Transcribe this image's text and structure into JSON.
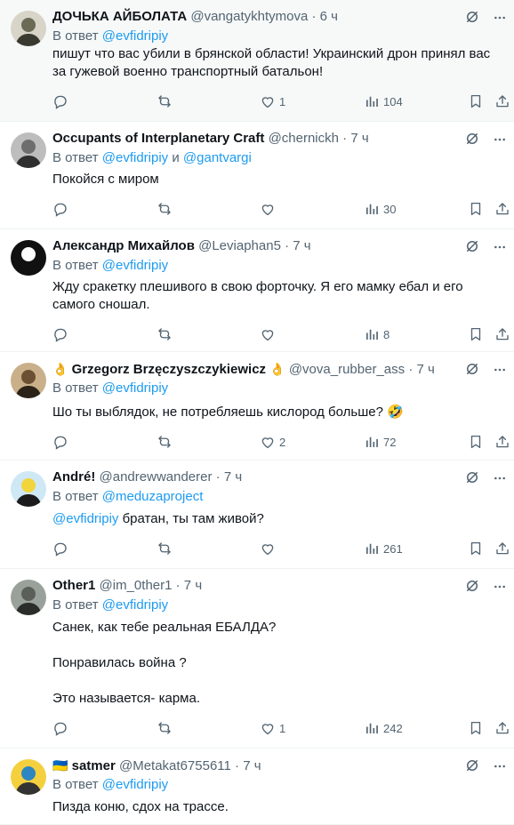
{
  "reply_prefix": "В ответ",
  "conjunction": "и",
  "tweets": [
    {
      "name": "ДОЧЬКА АЙБОЛАТА",
      "name_emoji": "",
      "name_emoji_after": "",
      "handle": "@vangatykhtymova",
      "time": "· 6 ч",
      "reply_to": [
        "@evfidripiy"
      ],
      "lines": [
        "пишут  что вас убили в брянской области! Украинский  дрон принял вас  за гужевой военно транспортный батальон!"
      ],
      "mention_lead": "",
      "replies": "",
      "retweets": "",
      "likes": "1",
      "views": "104",
      "avatar_colors": [
        "#d8d4c8",
        "#6a6a55",
        "#3a3a30"
      ]
    },
    {
      "name": "Occupants of Interplanetary Craft",
      "name_emoji": "",
      "name_emoji_after": "",
      "handle": "@chernickh",
      "time": "· 7 ч",
      "reply_to": [
        "@evfidripiy",
        "@gantvargi"
      ],
      "lines": [
        "Покойся с миром"
      ],
      "mention_lead": "",
      "replies": "",
      "retweets": "",
      "likes": "",
      "views": "30",
      "avatar_colors": [
        "#bdbdbd",
        "#6e6e6e",
        "#2f2f2f"
      ]
    },
    {
      "name": "Александр Михайлов",
      "name_emoji": "",
      "name_emoji_after": "",
      "handle": "@Leviaphan5",
      "time": "· 7 ч",
      "reply_to": [
        "@evfidripiy"
      ],
      "lines": [
        "Жду сракетку плешивого в свою форточку. Я его мамку ебал и его самого сношал."
      ],
      "mention_lead": "",
      "replies": "",
      "retweets": "",
      "likes": "",
      "views": "8",
      "avatar_colors": [
        "#111111",
        "#ffffff",
        "#111111"
      ]
    },
    {
      "name": "Grzegorz Brzęczyszczykiewicz",
      "name_emoji": "👌",
      "name_emoji_after": "👌",
      "handle": "@vova_rubber_ass",
      "time": "· 7 ч",
      "reply_to": [
        "@evfidripiy"
      ],
      "lines": [
        "Шо ты выблядок, не потребляешь кислород больше? 🤣"
      ],
      "mention_lead": "",
      "replies": "",
      "retweets": "",
      "likes": "2",
      "views": "72",
      "avatar_colors": [
        "#c9b08a",
        "#6b5033",
        "#2b2218"
      ]
    },
    {
      "name": "André!",
      "name_emoji": "",
      "name_emoji_after": "",
      "handle": "@andrewwanderer",
      "time": "· 7 ч",
      "reply_to": [
        "@meduzaproject"
      ],
      "lines": [
        "братан, ты там живой?"
      ],
      "mention_lead": "@evfidripiy",
      "replies": "",
      "retweets": "",
      "likes": "",
      "views": "261",
      "avatar_colors": [
        "#cfe8f5",
        "#f2d43c",
        "#1b1b1b"
      ]
    },
    {
      "name": "Other1",
      "name_emoji": "",
      "name_emoji_after": "",
      "handle": "@im_0ther1",
      "time": "· 7 ч",
      "reply_to": [
        "@evfidripiy"
      ],
      "lines": [
        "Санек, как тебе реальная ЕБАЛДА?",
        "",
        "Понравилась война ?",
        "",
        "Это называется- карма."
      ],
      "mention_lead": "",
      "replies": "",
      "retweets": "",
      "likes": "1",
      "views": "242",
      "avatar_colors": [
        "#9aa19a",
        "#5a5f5a",
        "#2a2d2a"
      ]
    },
    {
      "name": "satmer",
      "name_emoji": "🇺🇦",
      "name_emoji_after": "",
      "handle": "@Metakat6755611",
      "time": "· 7 ч",
      "reply_to": [
        "@evfidripiy"
      ],
      "lines": [
        "Пизда коню, сдох на трассе."
      ],
      "mention_lead": "",
      "replies": "",
      "retweets": "",
      "likes": "",
      "views": "",
      "avatar_colors": [
        "#f4d03f",
        "#2e86c1",
        "#333333"
      ]
    }
  ],
  "colors": {
    "link": "#1d9bf0",
    "muted": "#536471",
    "text": "#0f1419",
    "highlight_bg": "#f7f9f9",
    "divider": "#eff3f4"
  },
  "icons": {
    "grok": "grok-icon",
    "more": "more-icon",
    "reply": "reply-icon",
    "retweet": "retweet-icon",
    "like": "like-icon",
    "views": "views-icon",
    "bookmark": "bookmark-icon",
    "share": "share-icon"
  }
}
